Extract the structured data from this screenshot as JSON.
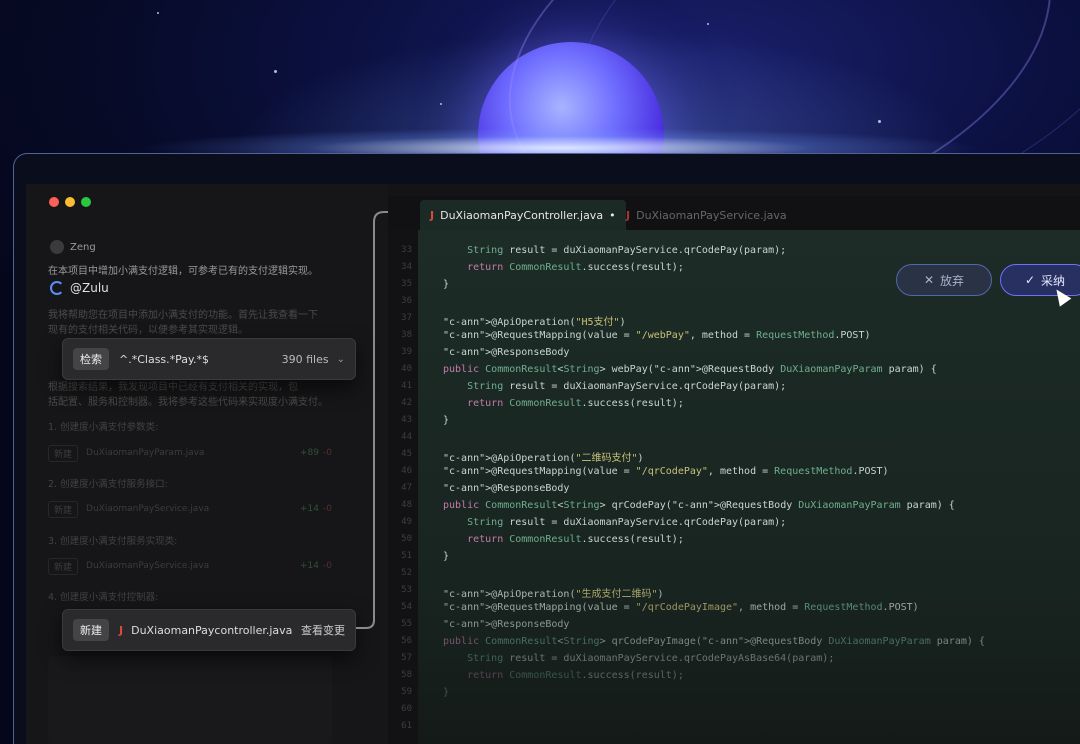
{
  "chat": {
    "user_name": "Zeng",
    "user_msg": "在本项目中增加小满支付逻辑，可参考已有的支付逻辑实现。",
    "agent_name": "@Zulu",
    "agent_msg_line1": "我将帮助您在项目中添加小满支付的功能。首先让我查看一下",
    "agent_msg_line2": "现有的支付相关代码，以便参考其实现逻辑。",
    "search_card": {
      "tag": "检索",
      "query": "^.*Class.*Pay.*$",
      "count": "390 files"
    },
    "result_line1": "根据搜索结果，我发现项目中已经有支付相关的实现，包",
    "result_line2": "括配置、服务和控制器。我将参考这些代码来实现度小满支付。",
    "steps": [
      {
        "label": "1. 创建度小满支付参数类:",
        "tag": "新建",
        "file": "DuXiaomanPayParam.java",
        "plus": "+89",
        "minus": "-0"
      },
      {
        "label": "2. 创建度小满支付服务接口:",
        "tag": "新建",
        "file": "DuXiaomanPayService.java",
        "plus": "+14",
        "minus": "-0"
      },
      {
        "label": "3. 创建度小满支付服务实现类:",
        "tag": "新建",
        "file": "DuXiaomanPayService.java",
        "plus": "+14",
        "minus": "-0"
      },
      {
        "label": "4. 创建度小满支付控制器:"
      }
    ],
    "new_card": {
      "tag": "新建",
      "file": "DuXiaomanPaycontroller.java",
      "action": "查看变更"
    }
  },
  "editor": {
    "tabs": [
      {
        "label": "DuXiaomanPayController.java",
        "modified": "•"
      },
      {
        "label": "DuXiaomanPayService.java"
      }
    ],
    "buttons": {
      "reject": "放弃",
      "accept": "采纳"
    },
    "line_numbers": [
      "33",
      "34",
      "35",
      "36",
      "37",
      "38",
      "39",
      "40",
      "41",
      "42",
      "43",
      "44",
      "45",
      "46",
      "47",
      "48",
      "49",
      "50",
      "51",
      "52",
      "53",
      "54",
      "55",
      "56",
      "57",
      "58",
      "59",
      "60",
      "61"
    ],
    "code": [
      "    String result = duXiaomanPayService.qrCodePay(param);",
      "    return CommonResult.success(result);",
      "}",
      "",
      "@ApiOperation(\"H5支付\")",
      "@RequestMapping(value = \"/webPay\", method = RequestMethod.POST)",
      "@ResponseBody",
      "public CommonResult<String> webPay(@RequestBody DuXiaomanPayParam param) {",
      "    String result = duXiaomanPayService.qrCodePay(param);",
      "    return CommonResult.success(result);",
      "}",
      "",
      "@ApiOperation(\"二维码支付\")",
      "@RequestMapping(value = \"/qrCodePay\", method = RequestMethod.POST)",
      "@ResponseBody",
      "public CommonResult<String> qrCodePay(@RequestBody DuXiaomanPayParam param) {",
      "    String result = duXiaomanPayService.qrCodePay(param);",
      "    return CommonResult.success(result);",
      "}",
      "",
      "@ApiOperation(\"生成支付二维码\")",
      "@RequestMapping(value = \"/qrCodePayImage\", method = RequestMethod.POST)",
      "@ResponseBody",
      "public CommonResult<String> qrCodePayImage(@RequestBody DuXiaomanPayParam param) {",
      "    String result = duXiaomanPayService.qrCodePayAsBase64(param);",
      "    return CommonResult.success(result);",
      "}"
    ]
  },
  "colors": {
    "accent": "#6a72ff",
    "close": "#ff5f57",
    "minimize": "#febc2e",
    "maximize": "#28c840"
  }
}
